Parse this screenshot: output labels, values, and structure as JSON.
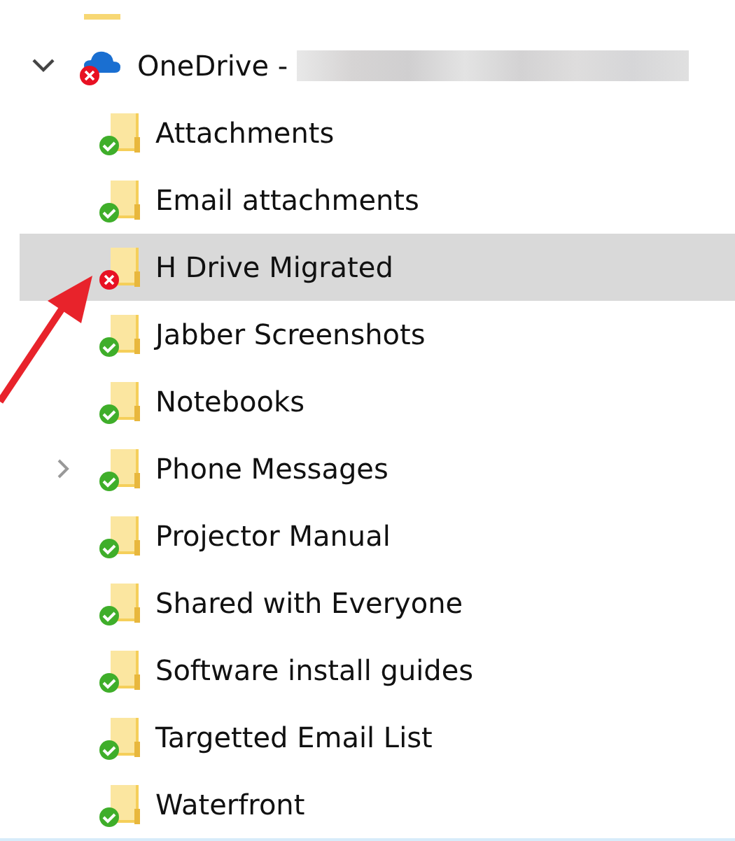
{
  "tree": {
    "label": "OneDrive -",
    "expanded": true,
    "sync_error": true,
    "redacted": true,
    "children": [
      {
        "label": "Attachments",
        "sync_error": false,
        "selected": false,
        "expandable": false
      },
      {
        "label": "Email attachments",
        "sync_error": false,
        "selected": false,
        "expandable": false
      },
      {
        "label": "H Drive Migrated",
        "sync_error": true,
        "selected": true,
        "expandable": false
      },
      {
        "label": "Jabber Screenshots",
        "sync_error": false,
        "selected": false,
        "expandable": false
      },
      {
        "label": "Notebooks",
        "sync_error": false,
        "selected": false,
        "expandable": false
      },
      {
        "label": "Phone Messages",
        "sync_error": false,
        "selected": false,
        "expandable": true
      },
      {
        "label": "Projector Manual",
        "sync_error": false,
        "selected": false,
        "expandable": false
      },
      {
        "label": "Shared with Everyone",
        "sync_error": false,
        "selected": false,
        "expandable": false
      },
      {
        "label": "Software install guides",
        "sync_error": false,
        "selected": false,
        "expandable": false
      },
      {
        "label": "Targetted Email List",
        "sync_error": false,
        "selected": false,
        "expandable": false
      },
      {
        "label": "Waterfront",
        "sync_error": false,
        "selected": false,
        "expandable": false
      }
    ]
  }
}
